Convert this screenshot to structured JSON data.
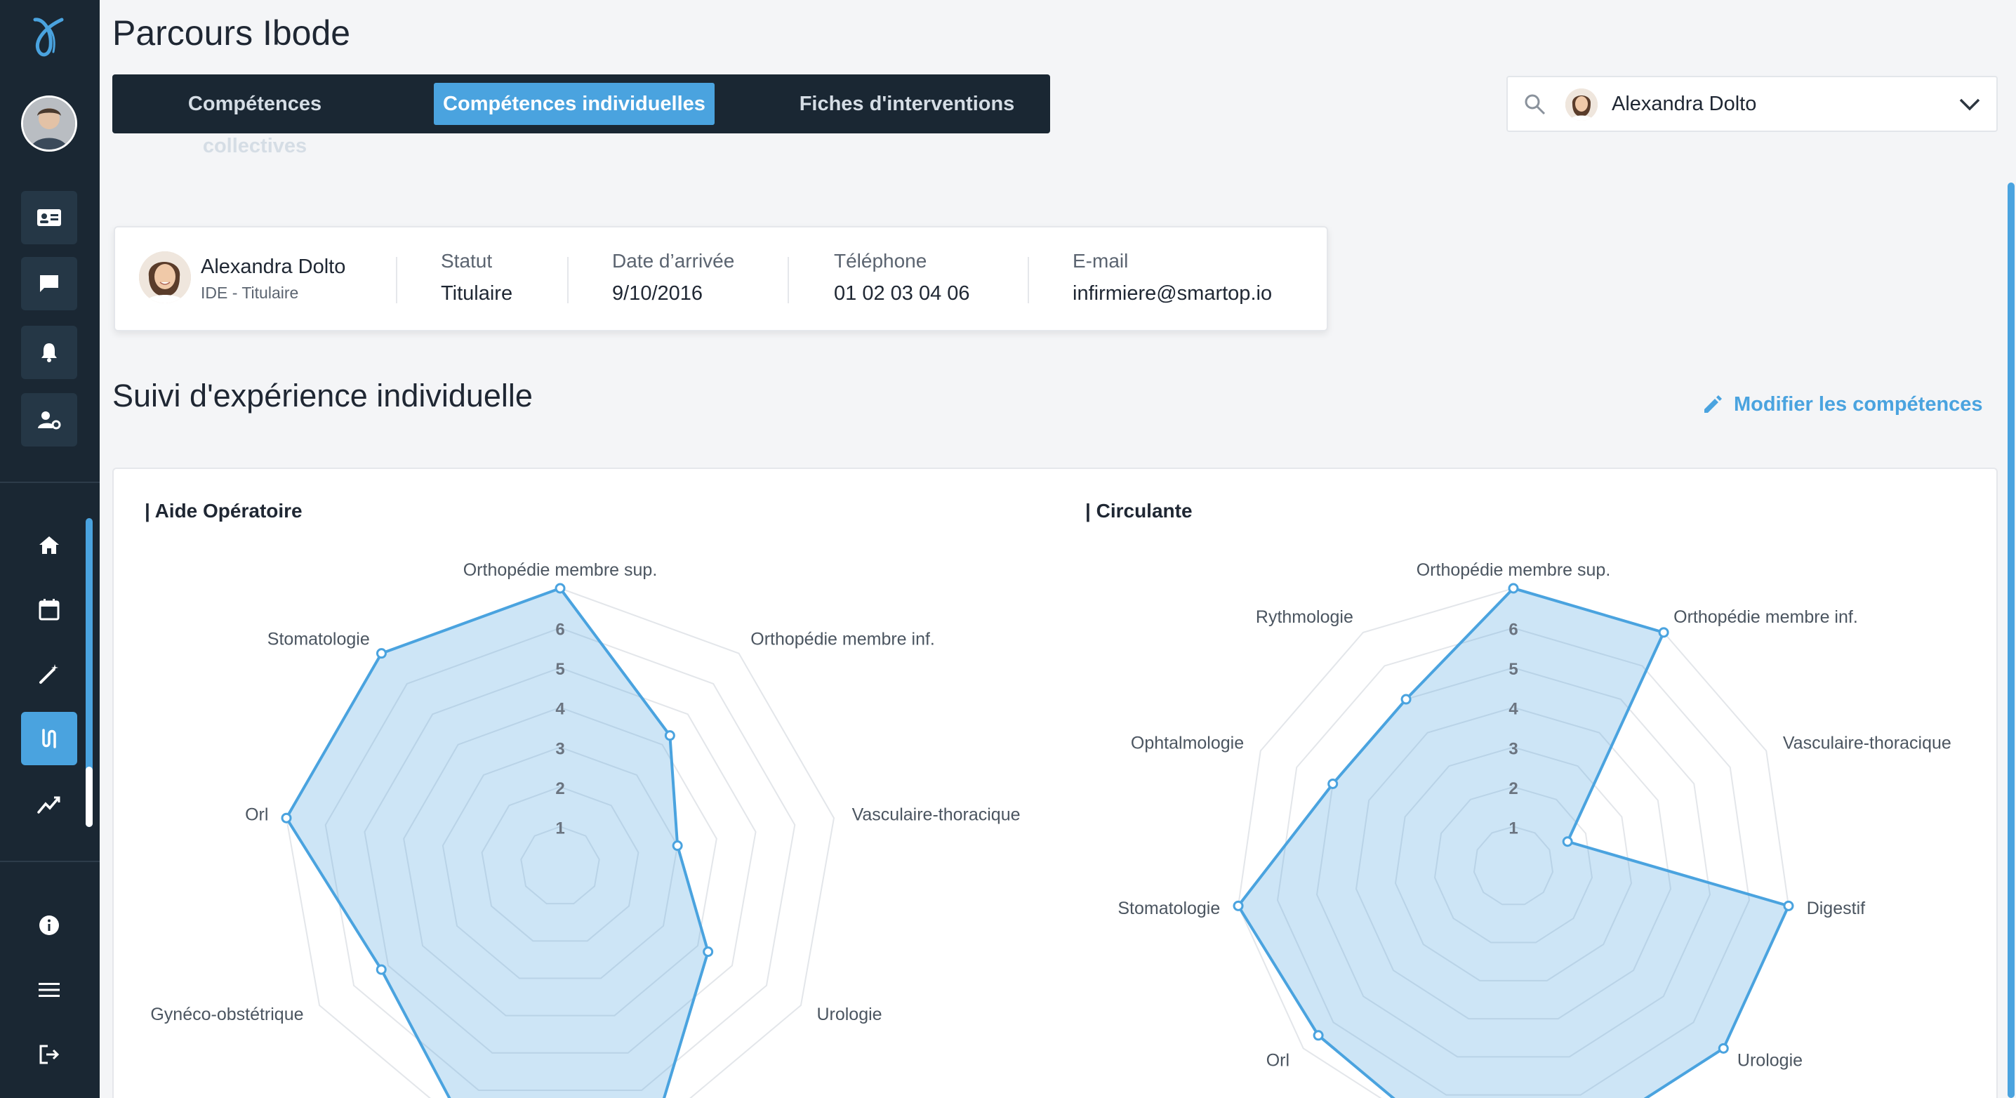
{
  "app": {
    "title": "Parcours Ibode"
  },
  "tabs": [
    {
      "label": "Compétences collectives"
    },
    {
      "label": "Compétences individuelles"
    },
    {
      "label": "Fiches d'interventions"
    }
  ],
  "user_select": {
    "selected": "Alexandra Dolto"
  },
  "profile": {
    "name": "Alexandra Dolto",
    "role": "IDE - Titulaire",
    "statut_label": "Statut",
    "statut_value": "Titulaire",
    "date_label": "Date d’arrivée",
    "date_value": "9/10/2016",
    "phone_label": "Téléphone",
    "phone_value": "01 02 03 04 06",
    "email_label": "E-mail",
    "email_value": "infirmiere@smartop.io"
  },
  "section": {
    "title": "Suivi d'expérience individuelle",
    "edit_label": "Modifier les compétences"
  },
  "colors": {
    "accent": "#4aa3df",
    "sidebar": "#1a2733",
    "fill": "rgba(74,163,223,0.28)"
  },
  "sidebar_icons": [
    "contact-card-icon",
    "chat-icon",
    "bell-icon",
    "user-settings-icon",
    "home-icon",
    "calendar-icon",
    "magic-wand-icon",
    "route-icon",
    "trending-icon",
    "info-icon",
    "menu-icon",
    "logout-icon"
  ],
  "chart_data": [
    {
      "type": "radar",
      "title": "| Aide Opératoire",
      "axes": [
        "Orthopédie membre sup.",
        "Orthopédie membre inf.",
        "Vasculaire-thoracique",
        "Urologie",
        "",
        "",
        "Gynéco-obstétrique",
        "Orl",
        "Stomatologie"
      ],
      "scale_labels": [
        "1",
        "2",
        "3",
        "4",
        "5",
        "6"
      ],
      "max": 7,
      "values": [
        7,
        4.3,
        3,
        4.3,
        7,
        7,
        5.2,
        7,
        7
      ]
    },
    {
      "type": "radar",
      "title": "| Circulante",
      "axes": [
        "Orthopédie membre sup.",
        "Orthopédie membre inf.",
        "Vasculaire-thoracique",
        "Digestif",
        "Urologie",
        "",
        "",
        "Orl",
        "Stomatologie",
        "Ophtalmologie",
        "Rythmologie"
      ],
      "scale_labels": [
        "1",
        "2",
        "3",
        "4",
        "5",
        "6"
      ],
      "max": 7,
      "values": [
        7,
        7,
        1.5,
        7,
        7,
        7,
        7,
        6.5,
        7,
        5,
        5
      ]
    }
  ]
}
